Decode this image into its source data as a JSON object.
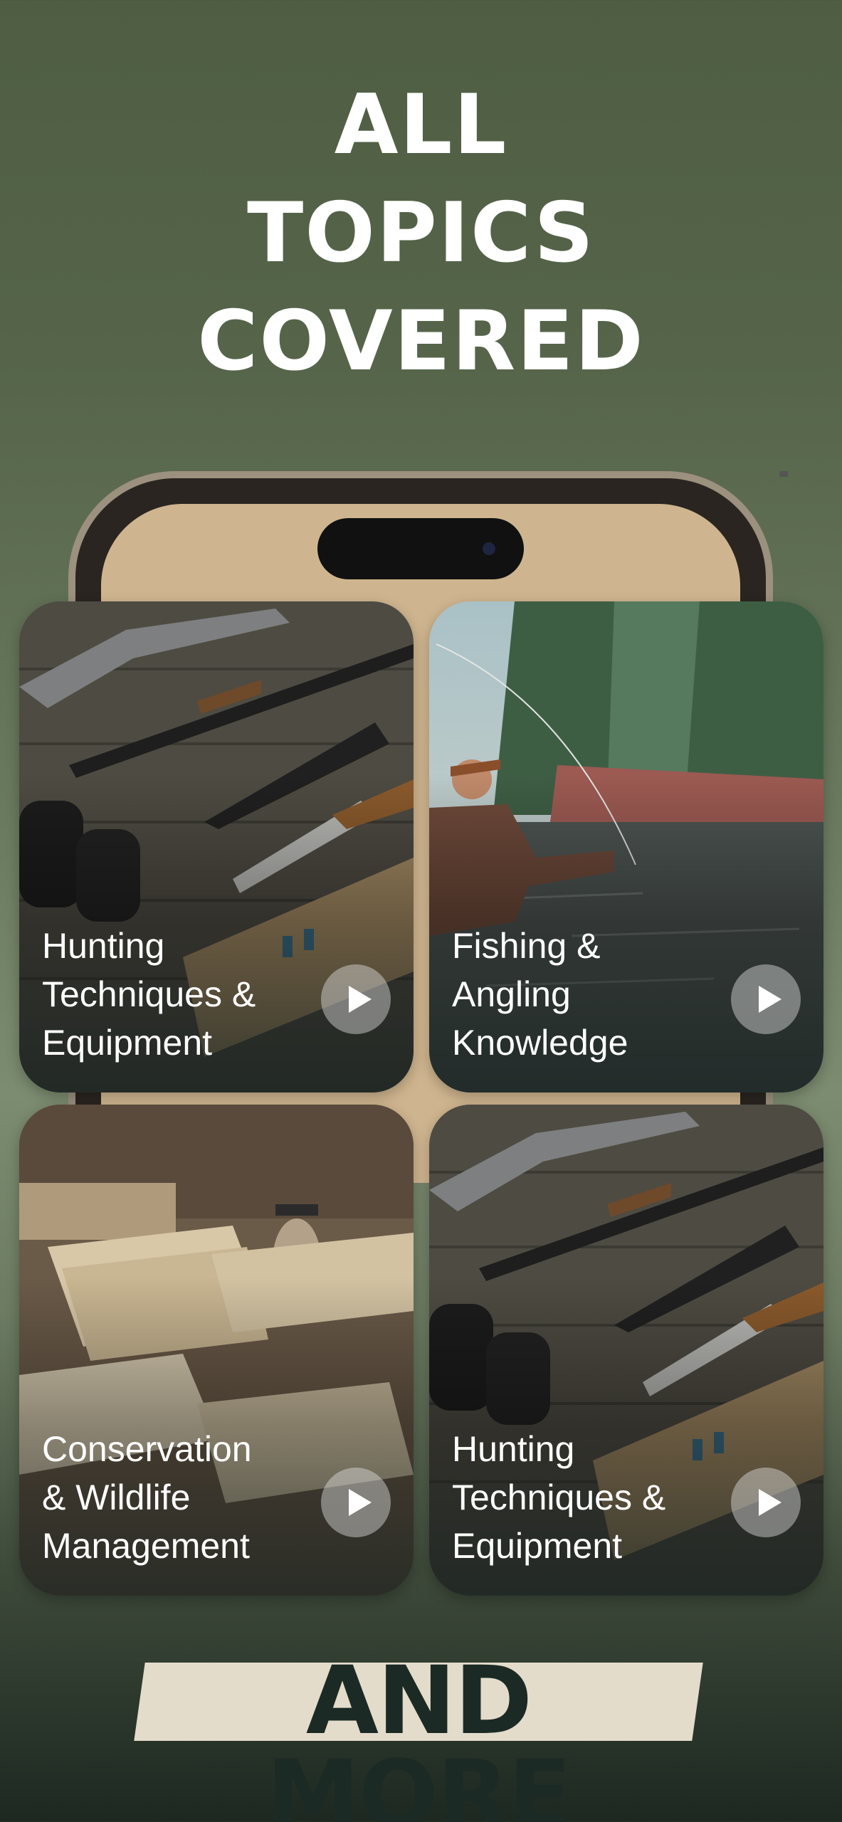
{
  "headline": {
    "line1": "ALL",
    "line2": "TOPICS",
    "line3": "COVERED"
  },
  "cards": [
    {
      "title": "Hunting\nTechniques &\nEquipment",
      "image": "hunting-gear-photo",
      "action_icon": "play-icon"
    },
    {
      "title": "Fishing &\nAngling\nKnowledge",
      "image": "fly-fishing-river-photo",
      "action_icon": "play-icon"
    },
    {
      "title": "Conservation\n& Wildlife\nManagement",
      "image": "books-and-lantern-photo",
      "action_icon": "play-icon"
    },
    {
      "title": "Hunting\nTechniques &\nEquipment",
      "image": "hunting-gear-photo",
      "action_icon": "play-icon"
    }
  ],
  "footer": {
    "label": "AND MORE"
  },
  "colors": {
    "background_top": "#4f5e43",
    "background_bottom": "#1d2821",
    "phone_screen": "#cfb58f",
    "andmore_plate": "#e4dccb",
    "andmore_text": "#1c2a25"
  }
}
